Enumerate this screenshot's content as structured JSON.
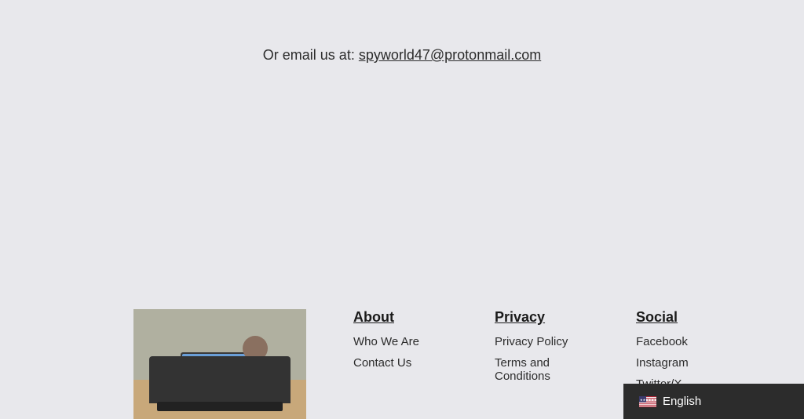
{
  "email_section": {
    "label": "Or email us at:",
    "email": "spyworld47@protonmail.com",
    "email_href": "mailto:spyworld47@protonmail.com"
  },
  "footer": {
    "about": {
      "heading": "About",
      "links": [
        {
          "label": "Who We Are",
          "href": "#"
        },
        {
          "label": "Contact Us",
          "href": "#"
        }
      ]
    },
    "privacy": {
      "heading": "Privacy",
      "links": [
        {
          "label": "Privacy Policy",
          "href": "#"
        },
        {
          "label": "Terms and Conditions",
          "href": "#"
        }
      ]
    },
    "social": {
      "heading": "Social",
      "links": [
        {
          "label": "Facebook",
          "href": "#"
        },
        {
          "label": "Instagram",
          "href": "#"
        },
        {
          "label": "Twitter/X",
          "href": "#"
        }
      ]
    }
  },
  "language_switcher": {
    "flag_alt": "US flag",
    "language": "English"
  }
}
